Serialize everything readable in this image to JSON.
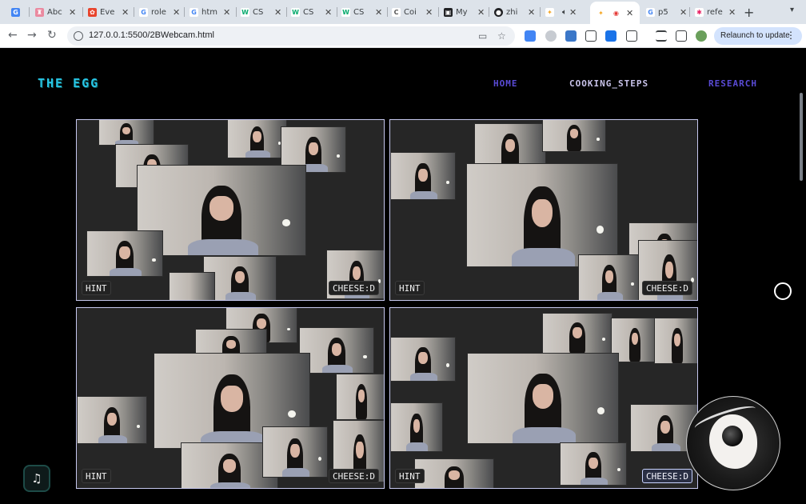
{
  "browser": {
    "tabs": [
      {
        "label": "",
        "icon": "translate-icon",
        "color": "#4285f4"
      },
      {
        "label": "Abc",
        "icon": "castle-icon",
        "color": "#ea8aa0"
      },
      {
        "label": "Eve",
        "icon": "flower-icon",
        "color": "#e8442c"
      },
      {
        "label": "role",
        "icon": "google-icon",
        "color": "#4285f4"
      },
      {
        "label": "htm",
        "icon": "google-icon",
        "color": "#4285f4"
      },
      {
        "label": "CS",
        "icon": "w3schools-icon",
        "color": "#04aa6d"
      },
      {
        "label": "CS",
        "icon": "w3schools-icon",
        "color": "#04aa6d"
      },
      {
        "label": "CS",
        "icon": "w3schools-icon",
        "color": "#04aa6d"
      },
      {
        "label": "Coi",
        "icon": "cc-icon",
        "color": "#9aa0a6"
      },
      {
        "label": "My",
        "icon": "app-icon",
        "color": "#202124"
      },
      {
        "label": "zhi",
        "icon": "github-icon",
        "color": "#202124"
      },
      {
        "label": "",
        "icon": "sun-icon",
        "color": "#f5c542"
      },
      {
        "label": "",
        "icon": "record-icon",
        "color": "#e53935"
      },
      {
        "label": "p5",
        "icon": "google-icon",
        "color": "#4285f4"
      },
      {
        "label": "refe",
        "icon": "star-icon",
        "color": "#e91e63"
      }
    ],
    "url": "127.0.0.1:5500/2BWebcam.html",
    "relaunch_label": "Relaunch to update"
  },
  "site": {
    "logo": "THE EGG",
    "nav": {
      "home": "HOME",
      "steps": "COOKING_STEPS",
      "research": "RESEARCH"
    }
  },
  "panels": [
    {
      "hint": "HINT",
      "cheese": "CHEESE:D"
    },
    {
      "hint": "HINT",
      "cheese": "CHEESE:D"
    },
    {
      "hint": "HINT",
      "cheese": "CHEESE:D"
    },
    {
      "hint": "HINT",
      "cheese": "CHEESE:D"
    }
  ],
  "icons": {
    "music": "music-note-icon",
    "egg": "egg-ball-icon"
  }
}
